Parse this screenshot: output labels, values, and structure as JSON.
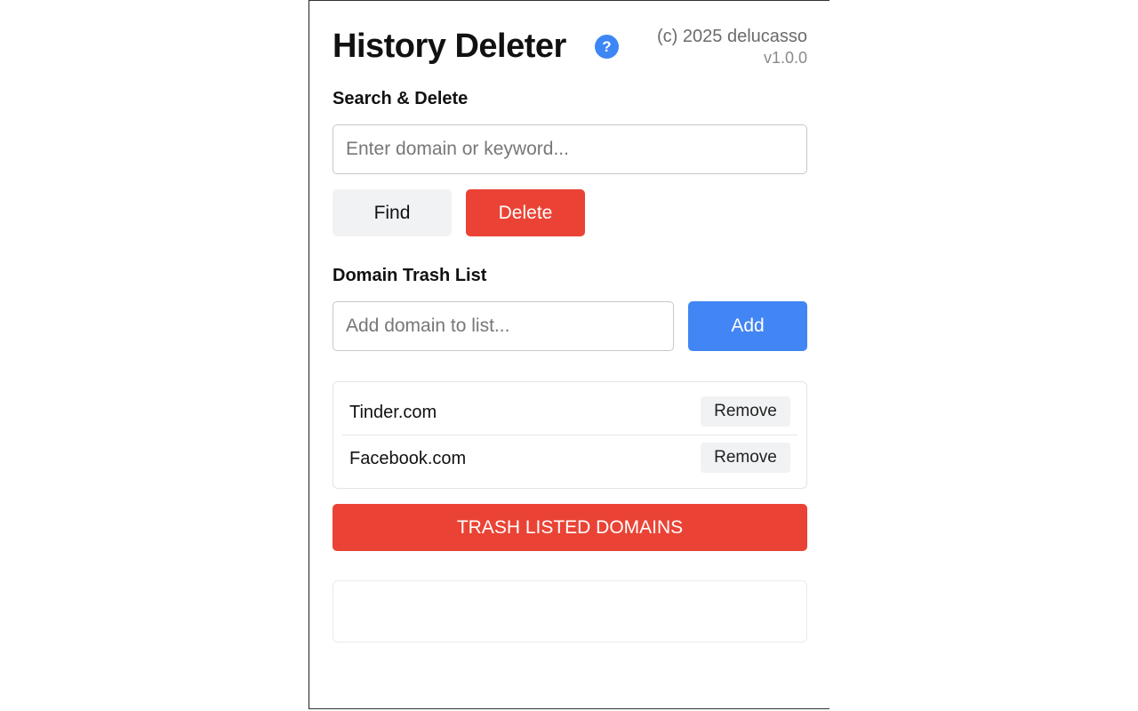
{
  "header": {
    "title": "History Deleter",
    "help_icon": "?",
    "credit": "(c) 2025 delucasso",
    "version": "v1.0.0"
  },
  "search_section": {
    "label": "Search & Delete",
    "input_placeholder": "Enter domain or keyword...",
    "input_value": "",
    "find_label": "Find",
    "delete_label": "Delete"
  },
  "trash_section": {
    "label": "Domain Trash List",
    "input_placeholder": "Add domain to list...",
    "input_value": "",
    "add_label": "Add",
    "items": [
      {
        "domain": "Tinder.com",
        "remove_label": "Remove"
      },
      {
        "domain": "Facebook.com",
        "remove_label": "Remove"
      }
    ],
    "trash_all_label": "TRASH LISTED DOMAINS"
  },
  "status": {
    "text": ""
  },
  "colors": {
    "accent_blue": "#4285f4",
    "danger_red": "#ea4335",
    "neutral_gray": "#f1f2f4"
  },
  "icons": {
    "help": "help-circle-icon"
  }
}
